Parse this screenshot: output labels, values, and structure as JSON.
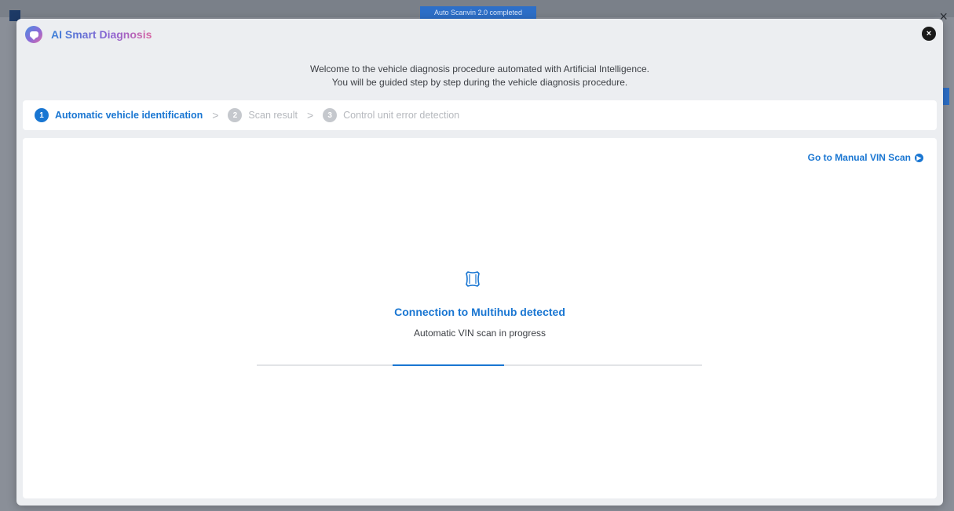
{
  "background": {
    "toast": "Auto Scanvin 2.0 completed",
    "close_glyph": "×"
  },
  "modal": {
    "title": "AI Smart Diagnosis",
    "close_glyph": "×",
    "welcome_line1": "Welcome to the vehicle diagnosis procedure automated with Artificial Intelligence.",
    "welcome_line2": "You will be guided step by step during the vehicle diagnosis procedure."
  },
  "stepper": {
    "steps": [
      {
        "number": "1",
        "label": "Automatic vehicle identification",
        "state": "active"
      },
      {
        "number": "2",
        "label": "Scan result",
        "state": "inactive"
      },
      {
        "number": "3",
        "label": "Control unit error detection",
        "state": "inactive"
      }
    ],
    "separator": ">"
  },
  "content": {
    "manual_link": "Go to Manual VIN Scan",
    "status_title": "Connection to Multihub detected",
    "status_subtitle": "Automatic VIN scan in progress",
    "progress_indicator": "indeterminate"
  },
  "colors": {
    "accent": "#1976d2",
    "inactive": "#c5c8cd"
  },
  "icons": {
    "app": "ai-chat-icon",
    "close": "close-icon",
    "link": "arrow-right-circle-icon",
    "device": "multihub-device-icon"
  }
}
